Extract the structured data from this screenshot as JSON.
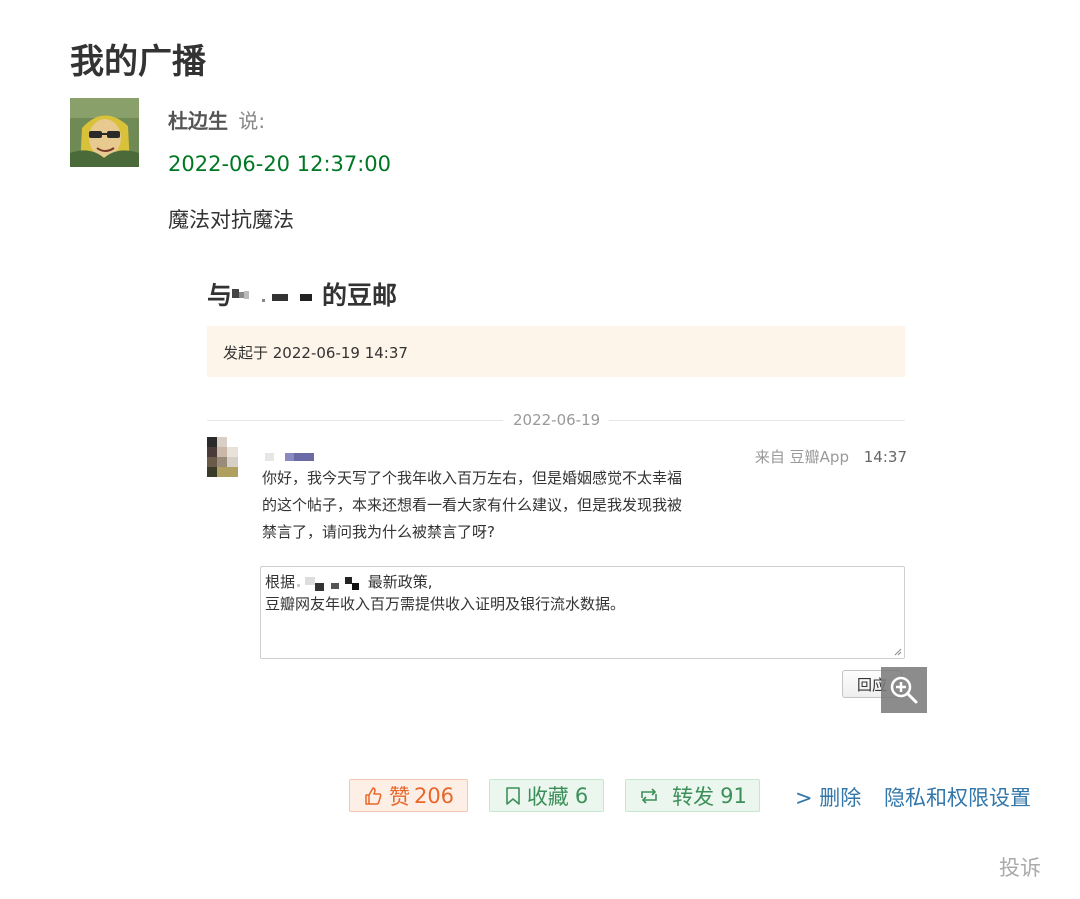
{
  "page": {
    "title": "我的广播"
  },
  "post": {
    "author": "杜边生",
    "says": "说:",
    "time": "2022-06-20 12:37:00",
    "text": "魔法对抗魔法"
  },
  "embedded_screenshot": {
    "title_prefix": "与",
    "title_suffix": "的豆邮",
    "started_label": "发起于 2022-06-19 14:37",
    "date_divider": "2022-06-19",
    "source": "来自 豆瓣App",
    "time": "14:37",
    "message_lines": [
      "你好，我今天写了个我年收入百万左右，但是婚姻感觉不太幸福",
      "的这个帖子，本来还想看一看大家有什么建议，但是我发现我被",
      "禁言了，请问我为什么被禁言了呀?"
    ],
    "reply_prefix": "根据",
    "reply_suffix": " 最新政策,",
    "reply_line2": "豆瓣网友年收入百万需提供收入证明及银行流水数据。",
    "reply_button": "回应"
  },
  "actions": {
    "like": {
      "label": "赞",
      "count": "206"
    },
    "collect": {
      "label": "收藏",
      "count": "6"
    },
    "share": {
      "label": "转发",
      "count": "91"
    },
    "delete": "> 删除",
    "privacy": "隐私和权限设置",
    "report": "投诉"
  },
  "colors": {
    "time_green": "#007722",
    "link_blue": "#3377aa",
    "like_orange": "#e8682a",
    "green_action": "#3d8f5a"
  },
  "icons": [
    "thumbs-up-icon",
    "bookmark-icon",
    "repost-icon",
    "zoom-in-icon",
    "resize-grip-icon"
  ]
}
